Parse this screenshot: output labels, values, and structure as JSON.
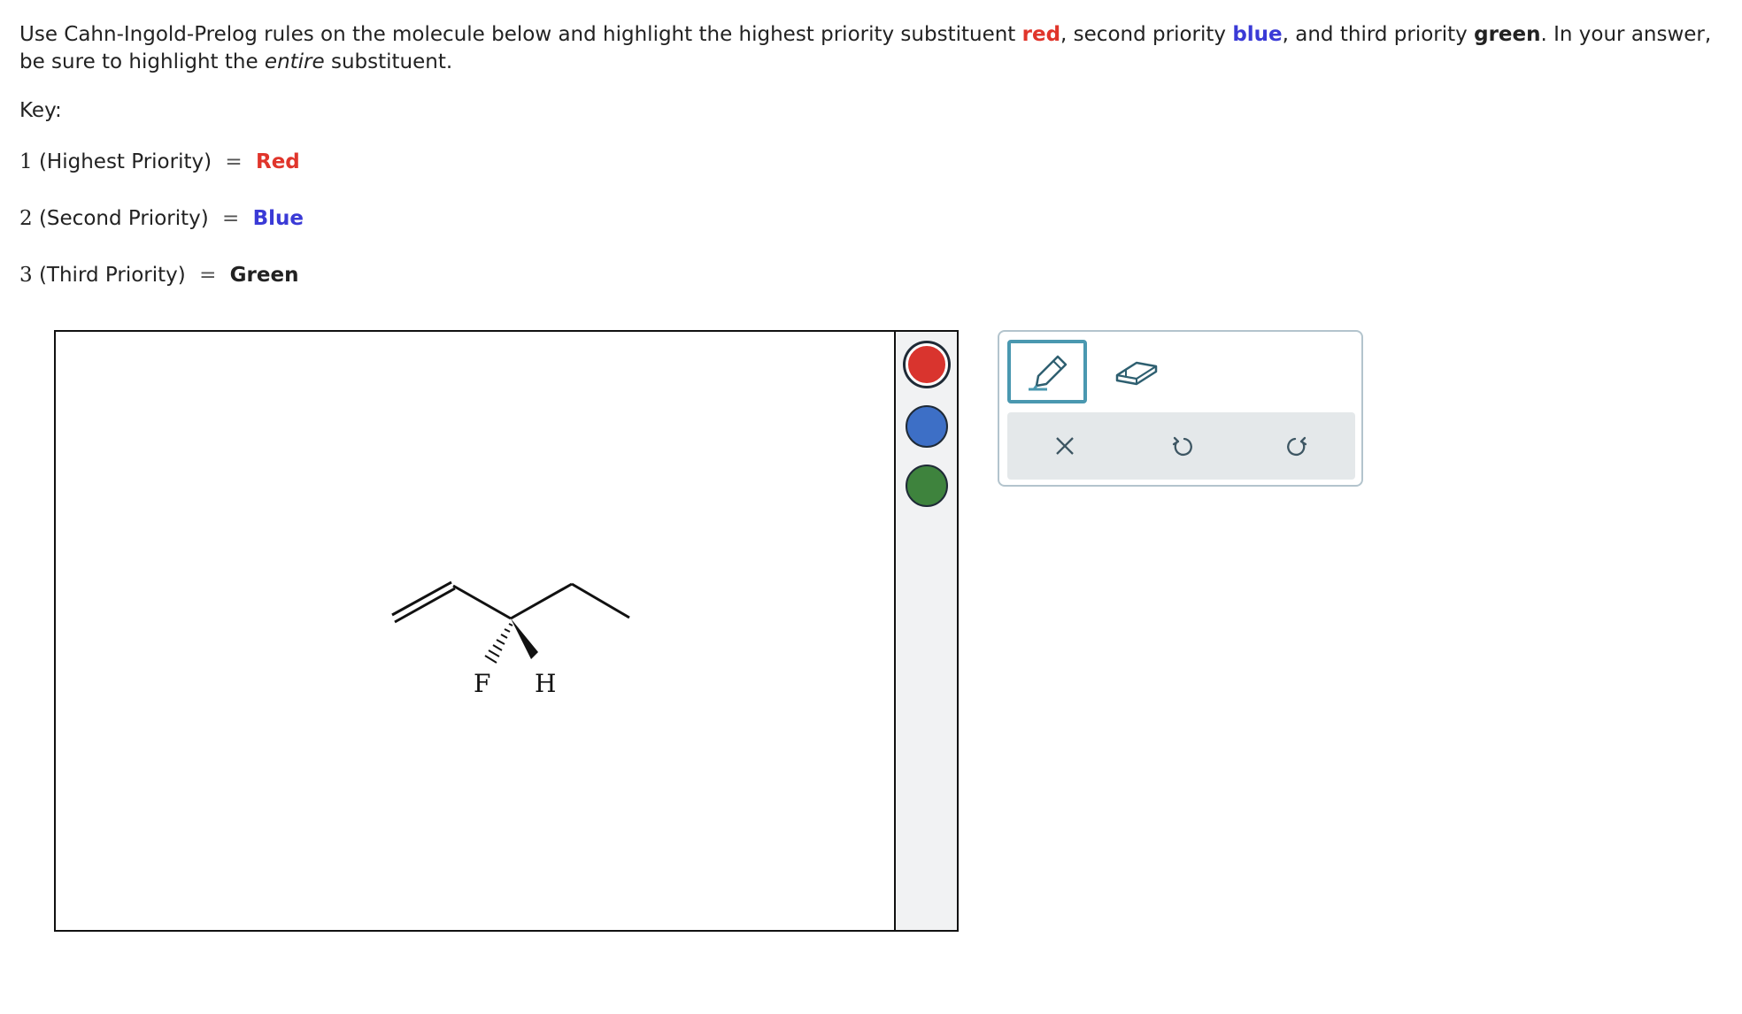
{
  "question": {
    "part1": "Use Cahn-Ingold-Prelog rules on the molecule below and highlight the highest priority substituent ",
    "red_word": "red",
    "part2": ", second priority ",
    "blue_word": "blue",
    "part3": ", and third priority ",
    "green_word": "green",
    "part4": ". In your answer, be sure to highlight the ",
    "entire_word": "entire",
    "part5": " substituent."
  },
  "key": {
    "label": "Key:",
    "rows": [
      {
        "num": "1",
        "text": "(Highest Priority)",
        "eq": "=",
        "color_name": "Red",
        "color": "#e0352b"
      },
      {
        "num": "2",
        "text": "(Second Priority)",
        "eq": "=",
        "color_name": "Blue",
        "color": "#3a3ad6"
      },
      {
        "num": "3",
        "text": "(Third Priority)",
        "eq": "=",
        "color_name": "Green",
        "color": "#222222"
      }
    ]
  },
  "molecule": {
    "atom_f": "F",
    "atom_h": "H"
  },
  "palette": {
    "red": "#d9342e",
    "blue": "#3d6fc6",
    "green": "#3e833d",
    "selected": "red"
  },
  "tools": {
    "highlighter_icon": "highlighter-icon",
    "eraser_icon": "eraser-icon",
    "clear_icon": "close-icon",
    "undo_icon": "undo-icon",
    "redo_icon": "redo-icon",
    "accent": "#4a98b0"
  }
}
